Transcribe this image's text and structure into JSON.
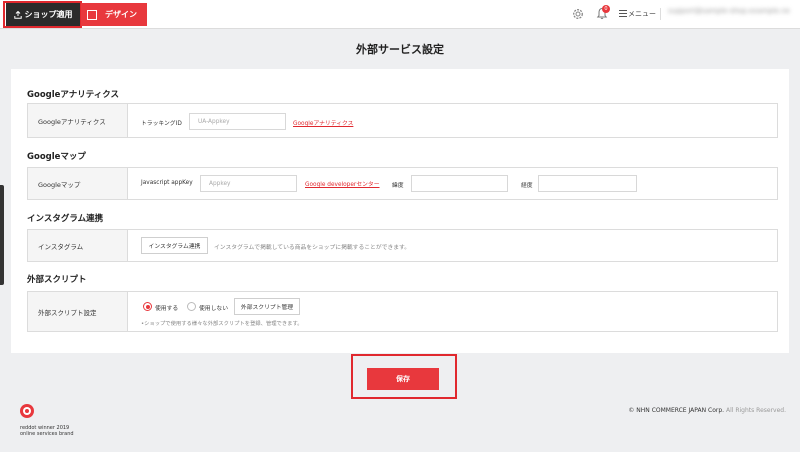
{
  "header": {
    "shop_apply_label": "ショップ適用",
    "design_label": "デザイン",
    "notification_count": "0",
    "menu_label": "メニュー",
    "account_email": "support@sample-shop.example.net"
  },
  "page": {
    "title": "外部サービス設定"
  },
  "sections": {
    "google_analytics": {
      "title": "Googleアナリティクス",
      "row_label": "Googleアナリティクス",
      "tracking_label": "トラッキングID",
      "tracking_placeholder": "UA-Appkey",
      "link_text": "Googleアナリティクス"
    },
    "google_maps": {
      "title": "Googleマップ",
      "row_label": "Googleマップ",
      "appkey_label": "Javascript appKey",
      "appkey_placeholder": "Appkey",
      "link_text": "Google developerセンター",
      "latitude_label": "緯度",
      "longitude_label": "経度",
      "latitude_value": "",
      "longitude_value": ""
    },
    "instagram": {
      "title": "インスタグラム連携",
      "row_label": "インスタグラム",
      "button_label": "インスタグラム連携",
      "description": "インスタグラムで掲載している商品をショップに掲載することができます。"
    },
    "external_script": {
      "title": "外部スクリプト",
      "row_label": "外部スクリプト設定",
      "use_label": "使用する",
      "not_use_label": "使用しない",
      "selected": "使用する",
      "manage_button_label": "外部スクリプト管理",
      "hint": "•ショップで使用する様々な外部スクリプトを登録、管理できます。"
    }
  },
  "save_label": "保存",
  "footer": {
    "copyright": "© NHN COMMERCE JAPAN Corp.",
    "rights": "All Rights Reserved.",
    "award_line1": "reddot winner 2019",
    "award_line2": "online services brand"
  },
  "colors": {
    "accent": "#e8383d",
    "dark_button": "#2b2b2b",
    "background": "#eeeff1"
  }
}
